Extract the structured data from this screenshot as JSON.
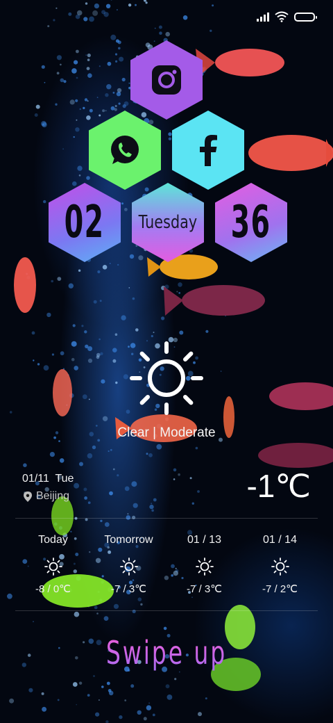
{
  "status_bar": {
    "signal_icon": "signal-bars-icon",
    "wifi_icon": "wifi-icon",
    "battery_icon": "battery-icon"
  },
  "shortcuts": [
    {
      "app": "Instagram",
      "icon": "instagram-icon",
      "color": "#a45be8"
    },
    {
      "app": "WhatsApp",
      "icon": "whatsapp-icon",
      "color": "#6bf26d"
    },
    {
      "app": "Facebook",
      "icon": "facebook-icon",
      "color": "#5be4f3"
    }
  ],
  "clock": {
    "hour": "02",
    "minute": "36",
    "weekday": "Tuesday"
  },
  "weather": {
    "condition": "Clear | Moderate",
    "date": "01/11  Tue",
    "city": "Beijing",
    "temperature": "-1℃",
    "icon": "sun-icon",
    "forecast": [
      {
        "label": "Today",
        "icon": "sun-icon",
        "range": "-8 / 0℃"
      },
      {
        "label": "Tomorrow",
        "icon": "sun-icon",
        "range": "-7 / 3℃"
      },
      {
        "label": "01 / 13",
        "icon": "sun-icon",
        "range": "-7 / 3℃"
      },
      {
        "label": "01 / 14",
        "icon": "sun-icon",
        "range": "-7 / 2℃"
      }
    ]
  },
  "swipe_hint": "Swipe up",
  "colors": {
    "accent_pink": "#f05ed9",
    "accent_purple": "#a86cf2"
  }
}
